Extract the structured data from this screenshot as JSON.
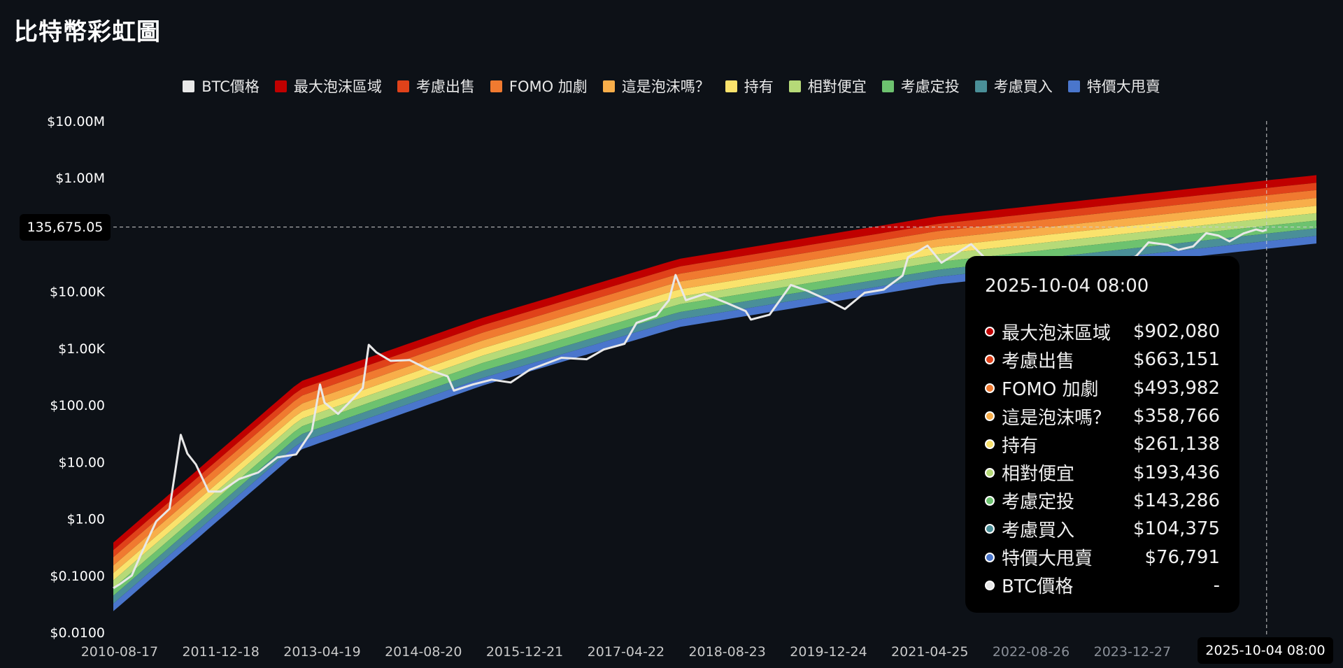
{
  "title": "比特幣彩虹圖",
  "legend": [
    {
      "label": "BTC價格",
      "color": "#e8e8e8"
    },
    {
      "label": "最大泡沫區域",
      "color": "#c00000"
    },
    {
      "label": "考慮出售",
      "color": "#e0421a"
    },
    {
      "label": "FOMO 加劇",
      "color": "#f07a30"
    },
    {
      "label": "這是泡沫嗎？",
      "color": "#f8ae4a"
    },
    {
      "label": "持有",
      "color": "#fae26c"
    },
    {
      "label": "相對便宜",
      "color": "#b6da78"
    },
    {
      "label": "考慮定投",
      "color": "#6dc26f"
    },
    {
      "label": "考慮買入",
      "color": "#4a8f98"
    },
    {
      "label": "特價大甩賣",
      "color": "#4a76cc"
    }
  ],
  "crosshair": {
    "price_label": "135,675.05",
    "date_label": "2025-10-04 08:00"
  },
  "tooltip": {
    "date": "2025-10-04 08:00",
    "rows": [
      {
        "name": "最大泡沫區域",
        "value": "$902,080",
        "color": "#c00000"
      },
      {
        "name": "考慮出售",
        "value": "$663,151",
        "color": "#e0421a"
      },
      {
        "name": "FOMO 加劇",
        "value": "$493,982",
        "color": "#f07a30"
      },
      {
        "name": "這是泡沫嗎？",
        "value": "$358,766",
        "color": "#f8ae4a"
      },
      {
        "name": "持有",
        "value": "$261,138",
        "color": "#fae26c"
      },
      {
        "name": "相對便宜",
        "value": "$193,436",
        "color": "#b6da78"
      },
      {
        "name": "考慮定投",
        "value": "$143,286",
        "color": "#6dc26f"
      },
      {
        "name": "考慮買入",
        "value": "$104,375",
        "color": "#4a8f98"
      },
      {
        "name": "特價大甩賣",
        "value": "$76,791",
        "color": "#4a76cc"
      },
      {
        "name": "BTC價格",
        "value": "-",
        "color": "#e8e8e8"
      }
    ]
  },
  "chart_data": {
    "type": "area",
    "title": "比特幣彩虹圖",
    "y_scale": "log",
    "ylim": [
      0.01,
      10000000
    ],
    "y_ticks": [
      "$0.0100",
      "$0.1000",
      "$1.00",
      "$10.00",
      "$100.00",
      "$1.00K",
      "$10.00K",
      "$1.00M",
      "$10.00M"
    ],
    "x_ticks": [
      "2010-08-17",
      "2011-12-18",
      "2013-04-19",
      "2014-08-20",
      "2015-12-21",
      "2017-04-22",
      "2018-08-23",
      "2019-12-24",
      "2021-04-25",
      "2022-08-26",
      "2023-12-27"
    ],
    "xlim": [
      "2010-07-18",
      "2026-06-01"
    ],
    "bands": [
      {
        "name": "特價大甩賣",
        "color": "#4a76cc",
        "upper": [
          0.032,
          22,
          300,
          3200,
          18000,
          76791,
          95000
        ]
      },
      {
        "name": "考慮買入",
        "color": "#4a8f98",
        "upper": [
          0.044,
          30,
          400,
          4300,
          24000,
          104375,
          129000
        ]
      },
      {
        "name": "考慮定投",
        "color": "#6dc26f",
        "upper": [
          0.06,
          41,
          550,
          5900,
          33000,
          143286,
          177000
        ]
      },
      {
        "name": "相對便宜",
        "color": "#b6da78",
        "upper": [
          0.082,
          56,
          740,
          8000,
          45000,
          193436,
          239000
        ]
      },
      {
        "name": "持有",
        "color": "#fae26c",
        "upper": [
          0.11,
          75,
          1000,
          10800,
          61000,
          261138,
          322000
        ]
      },
      {
        "name": "這是泡沫嗎？",
        "color": "#f8ae4a",
        "upper": [
          0.15,
          103,
          1370,
          14800,
          83500,
          358766,
          442000
        ]
      },
      {
        "name": "FOMO 加劇",
        "color": "#f07a30",
        "upper": [
          0.21,
          142,
          1880,
          20400,
          115000,
          493982,
          609000
        ]
      },
      {
        "name": "考慮出售",
        "color": "#e0421a",
        "upper": [
          0.28,
          190,
          2530,
          27400,
          154000,
          663151,
          818000
        ]
      },
      {
        "name": "最大泡沫區域",
        "color": "#c00000",
        "upper": [
          0.38,
          258,
          3440,
          37300,
          210000,
          902080,
          1113000
        ]
      }
    ],
    "band_dates": [
      "2010-07-18",
      "2013-01-01",
      "2015-06-01",
      "2018-01-01",
      "2021-06-01",
      "2025-10-04",
      "2026-06-01"
    ],
    "btc_price": {
      "name": "BTC價格",
      "color": "#e8e8e8",
      "dates": [
        "2010-07-18",
        "2010-08-17",
        "2010-10-15",
        "2010-12-01",
        "2011-02-10",
        "2011-04-15",
        "2011-06-08",
        "2011-07-10",
        "2011-08-20",
        "2011-10-20",
        "2011-12-18",
        "2012-03-15",
        "2012-06-15",
        "2012-09-15",
        "2012-12-15",
        "2013-03-01",
        "2013-04-09",
        "2013-05-01",
        "2013-07-05",
        "2013-09-15",
        "2013-11-01",
        "2013-11-30",
        "2014-01-05",
        "2014-03-15",
        "2014-06-15",
        "2014-09-15",
        "2014-12-15",
        "2015-01-14",
        "2015-04-15",
        "2015-07-15",
        "2015-10-15",
        "2016-01-15",
        "2016-06-15",
        "2016-10-15",
        "2017-01-05",
        "2017-04-15",
        "2017-06-12",
        "2017-09-15",
        "2017-11-15",
        "2017-12-17",
        "2018-02-05",
        "2018-05-05",
        "2018-08-15",
        "2018-11-20",
        "2018-12-15",
        "2019-03-15",
        "2019-06-26",
        "2019-09-15",
        "2019-12-15",
        "2020-03-12",
        "2020-06-15",
        "2020-09-15",
        "2020-12-15",
        "2021-01-10",
        "2021-04-14",
        "2021-06-20",
        "2021-09-01",
        "2021-11-10",
        "2022-01-25",
        "2022-05-15",
        "2022-06-18",
        "2022-09-15",
        "2022-11-21",
        "2023-02-15",
        "2023-06-15",
        "2023-10-15",
        "2024-01-15",
        "2024-03-14",
        "2024-06-15",
        "2024-08-05",
        "2024-10-15",
        "2024-12-17",
        "2025-02-15",
        "2025-04-08",
        "2025-06-15",
        "2025-08-14",
        "2025-09-15",
        "2025-10-04"
      ],
      "values": [
        0.06,
        0.07,
        0.1,
        0.25,
        0.9,
        1.5,
        30,
        14,
        9,
        3,
        3,
        5,
        6.5,
        12,
        13.5,
        35,
        230,
        110,
        70,
        130,
        200,
        1150,
        850,
        600,
        620,
        420,
        320,
        180,
        230,
        280,
        250,
        420,
        680,
        640,
        950,
        1200,
        2800,
        3700,
        7000,
        19500,
        7000,
        9000,
        6400,
        4500,
        3200,
        3900,
        13000,
        10200,
        7200,
        4900,
        9500,
        10800,
        19000,
        40000,
        64000,
        32000,
        47000,
        68000,
        36000,
        30000,
        18000,
        19500,
        15800,
        23000,
        26000,
        28500,
        42000,
        73000,
        66000,
        54000,
        62000,
        106000,
        96000,
        76000,
        105000,
        123000,
        115000,
        122000
      ]
    }
  }
}
